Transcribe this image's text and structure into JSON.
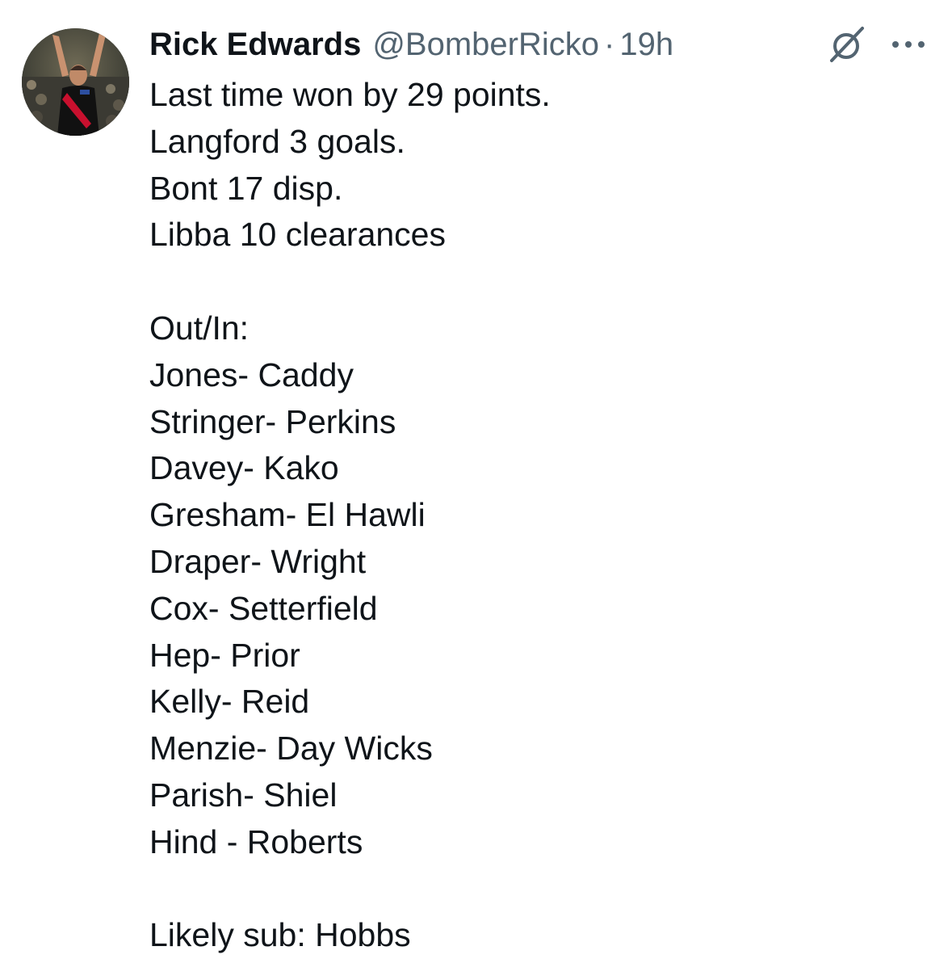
{
  "tweet": {
    "author": {
      "display_name": "Rick Edwards",
      "handle": "@BomberRicko",
      "separator": "·",
      "timestamp": "19h"
    },
    "icons": {
      "grok": "grok-icon",
      "more": "more-icon"
    },
    "colors": {
      "text": "#0f1419",
      "secondary": "#536471",
      "icon": "#536471"
    },
    "body_lines": [
      "Last time won by 29 points.",
      "Langford 3 goals.",
      "Bont 17 disp.",
      "Libba 10 clearances",
      "",
      "Out/In:",
      "Jones- Caddy",
      "Stringer- Perkins",
      "Davey- Kako",
      "Gresham- El Hawli",
      "Draper- Wright",
      "Cox- Setterfield",
      "Hep- Prior",
      "Kelly- Reid",
      "Menzie- Day Wicks",
      "Parish- Shiel",
      "Hind - Roberts",
      "",
      "Likely sub: Hobbs"
    ]
  }
}
